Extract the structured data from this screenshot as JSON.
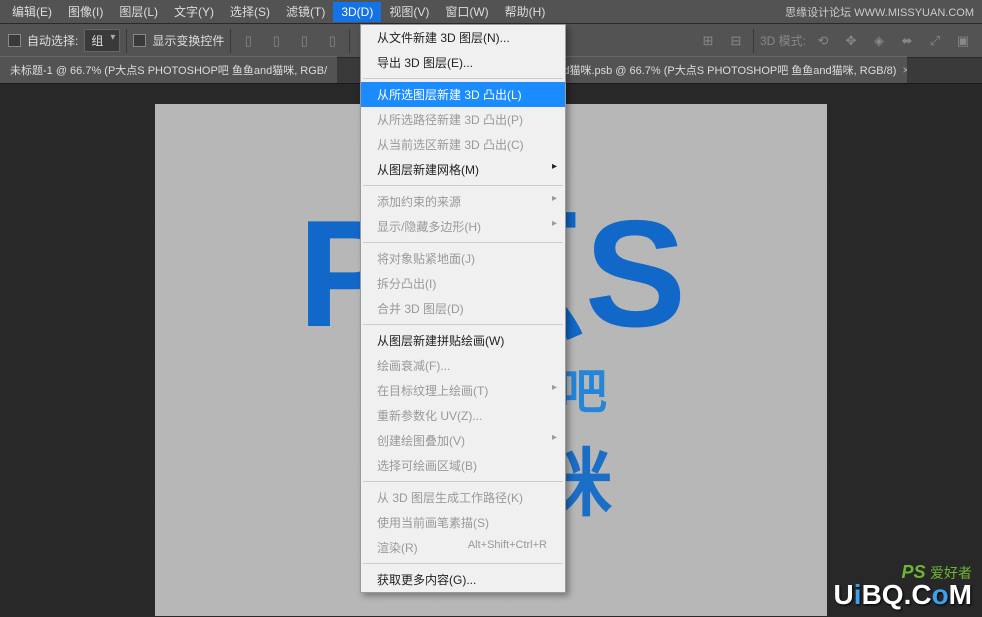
{
  "menubar": {
    "items": [
      {
        "label": "编辑(E)"
      },
      {
        "label": "图像(I)"
      },
      {
        "label": "图层(L)"
      },
      {
        "label": "文字(Y)"
      },
      {
        "label": "选择(S)"
      },
      {
        "label": "滤镜(T)"
      },
      {
        "label": "3D(D)"
      },
      {
        "label": "视图(V)"
      },
      {
        "label": "窗口(W)"
      },
      {
        "label": "帮助(H)"
      }
    ],
    "active_index": 6
  },
  "options_bar": {
    "auto_select_label": "自动选择:",
    "group_select_value": "组",
    "show_transform_label": "显示变换控件",
    "mode_label": "3D 模式:"
  },
  "tabs": [
    {
      "title": "未标题-1 @ 66.7% (P大点S  PHOTOSHOP吧 鱼鱼and猫咪, RGB/"
    },
    {
      "title": "nd猫咪.psb @ 66.7% (P大点S  PHOTOSHOP吧 鱼鱼and猫咪, RGB/8)"
    }
  ],
  "canvas": {
    "big": "P       点S",
    "sub": "PH               HOP吧",
    "cn": "鱼     猫咪"
  },
  "dropdown": {
    "items": [
      {
        "type": "item",
        "label": "从文件新建 3D 图层(N)..."
      },
      {
        "type": "item",
        "label": "导出 3D 图层(E)..."
      },
      {
        "type": "sep"
      },
      {
        "type": "item",
        "label": "从所选图层新建 3D 凸出(L)",
        "highlighted": true
      },
      {
        "type": "item",
        "label": "从所选路径新建 3D 凸出(P)",
        "disabled": true
      },
      {
        "type": "item",
        "label": "从当前选区新建 3D 凸出(C)",
        "disabled": true
      },
      {
        "type": "item",
        "label": "从图层新建网格(M)",
        "has_sub": true
      },
      {
        "type": "sep"
      },
      {
        "type": "item",
        "label": "添加约束的来源",
        "disabled": true,
        "has_sub": true
      },
      {
        "type": "item",
        "label": "显示/隐藏多边形(H)",
        "disabled": true,
        "has_sub": true
      },
      {
        "type": "sep"
      },
      {
        "type": "item",
        "label": "将对象贴紧地面(J)",
        "disabled": true
      },
      {
        "type": "item",
        "label": "拆分凸出(I)",
        "disabled": true
      },
      {
        "type": "item",
        "label": "合并 3D 图层(D)",
        "disabled": true
      },
      {
        "type": "sep"
      },
      {
        "type": "item",
        "label": "从图层新建拼贴绘画(W)"
      },
      {
        "type": "item",
        "label": "绘画衰减(F)...",
        "disabled": true
      },
      {
        "type": "item",
        "label": "在目标纹理上绘画(T)",
        "disabled": true,
        "has_sub": true
      },
      {
        "type": "item",
        "label": "重新参数化 UV(Z)...",
        "disabled": true
      },
      {
        "type": "item",
        "label": "创建绘图叠加(V)",
        "disabled": true,
        "has_sub": true
      },
      {
        "type": "item",
        "label": "选择可绘画区域(B)",
        "disabled": true
      },
      {
        "type": "sep"
      },
      {
        "type": "item",
        "label": "从 3D 图层生成工作路径(K)",
        "disabled": true
      },
      {
        "type": "item",
        "label": "使用当前画笔素描(S)",
        "disabled": true
      },
      {
        "type": "item",
        "label": "渲染(R)",
        "disabled": true,
        "shortcut": "Alt+Shift+Ctrl+R"
      },
      {
        "type": "sep"
      },
      {
        "type": "item",
        "label": "获取更多内容(G)..."
      }
    ]
  },
  "watermark": {
    "top": "思缘设计论坛  WWW.MISSYUAN.COM",
    "ps_label": "PS",
    "ps_cn": "爱好者",
    "uibq": "UiBQ.CoM"
  }
}
